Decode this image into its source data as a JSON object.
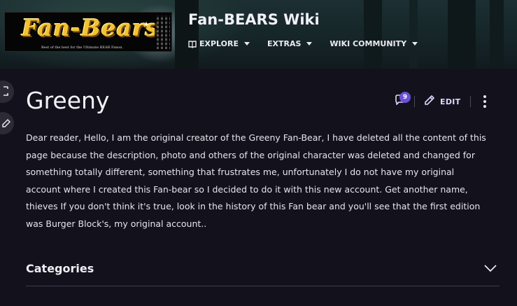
{
  "wiki": {
    "title": "Fan-BEARS Wiki",
    "logo_text": "Fan-Bears",
    "logo_tagline": "Best of the best for the Ultimate BEAR Fanon."
  },
  "nav": {
    "items": [
      {
        "label": "EXPLORE",
        "icon": "compass-icon"
      },
      {
        "label": "EXTRAS"
      },
      {
        "label": "WIKI COMMUNITY"
      }
    ]
  },
  "page": {
    "title": "Greeny",
    "comments_count": "9",
    "edit_label": "EDIT",
    "body_lines": [
      "Dear reader, Hello, I am the original creator of the Greeny Fan-Bear, I have deleted all the content of this",
      "page because the description, photo and others of the original character was deleted and changed for",
      "something totally different, something that frustrates me, unfortunately I do not have my original",
      "account where I created this Fan-bear so I decided to do it with this new account. Get another name,",
      "thieves If you don't think it's true, look in the history of this Fan bear and you'll see that the first edition",
      "was Burger Block's, my original account.."
    ]
  },
  "categories": {
    "label": "Categories"
  },
  "colors": {
    "background": "#13121c",
    "accent": "#6b4fd8",
    "edit_text": "#dcd8ff"
  }
}
